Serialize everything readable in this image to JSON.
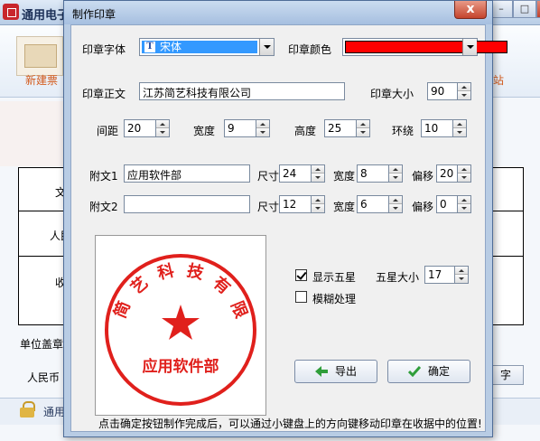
{
  "background_app": {
    "title": "通用电子",
    "controls": {
      "minimize": "–",
      "maximize": "□",
      "close": "x"
    },
    "toolbar_left_label": "新建票",
    "toolbar_right_label": "站",
    "form_cells": [
      "文",
      "人民",
      "收"
    ],
    "label_stamp": "单位盖章",
    "label_rmb": "人民币",
    "right_button": "字",
    "bottom_text": "通用"
  },
  "dialog": {
    "title": "制作印章",
    "close_label": "x",
    "font_label": "印章字体",
    "font_value": "宋体",
    "color_label": "印章颜色",
    "seal_color": "#ff0000",
    "main_text_label": "印章正文",
    "main_text_value": "江苏简艺科技有限公司",
    "size_label": "印章大小",
    "size_value": "90",
    "spacing_label": "间距",
    "spacing_value": "20",
    "width_label": "宽度",
    "width_value": "9",
    "height_label": "高度",
    "height_value": "25",
    "loop_label": "环绕",
    "loop_value": "10",
    "sub1_label": "附文1",
    "sub1_value": "应用软件部",
    "sub1_size_label": "尺寸",
    "sub1_size_value": "24",
    "sub1_width_label": "宽度",
    "sub1_width_value": "8",
    "sub1_offset_label": "偏移",
    "sub1_offset_value": "20",
    "sub2_label": "附文2",
    "sub2_value": "",
    "sub2_size_label": "尺寸",
    "sub2_size_value": "12",
    "sub2_width_label": "宽度",
    "sub2_width_value": "6",
    "sub2_offset_label": "偏移",
    "sub2_offset_value": "0",
    "show_star_label": "显示五星",
    "show_star_checked": true,
    "star_size_label": "五星大小",
    "star_size_value": "17",
    "blur_label": "模糊处理",
    "blur_checked": false,
    "export_button": "导出",
    "ok_button": "确定",
    "hint": "点击确定按钮制作完成后，可以通过小键盘上的方向键移动印章在收据中的位置!"
  },
  "seal_preview": {
    "arc_text": "江苏简艺科技有限公司",
    "bottom_text": "应用软件部",
    "color": "#e0201c"
  }
}
